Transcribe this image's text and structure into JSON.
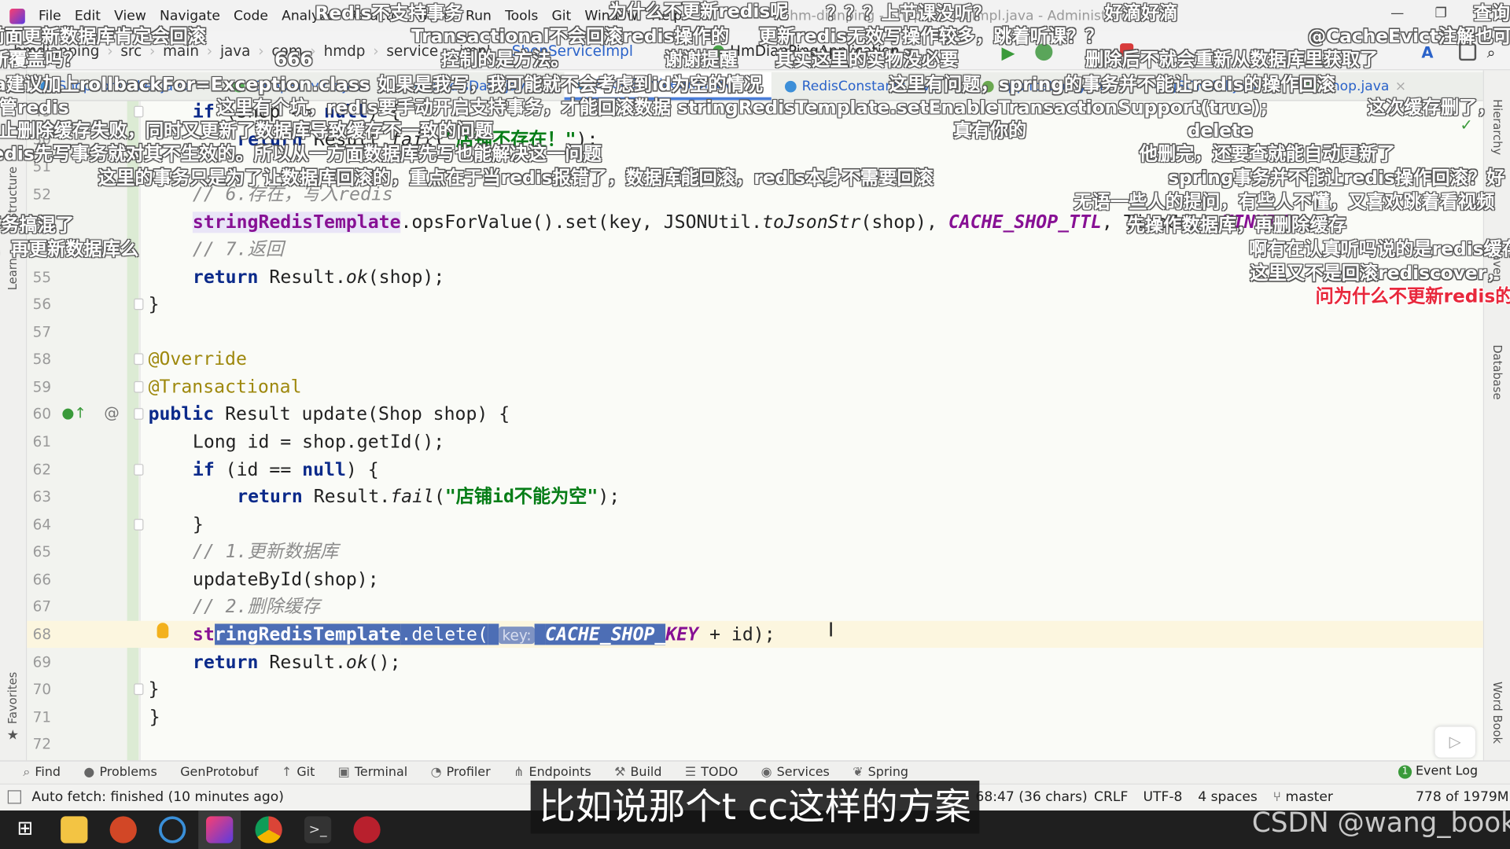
{
  "menu": [
    "File",
    "Edit",
    "View",
    "Navigate",
    "Code",
    "Analyze",
    "Refactor",
    "Build",
    "Run",
    "Tools",
    "Git",
    "Window",
    "Help"
  ],
  "window_title": "hm-dianping - ShopServiceImpl.java - Administrator",
  "breadcrumb": [
    "hmdianping",
    "src",
    "main",
    "java",
    "com",
    "hmdp",
    "service",
    "impl",
    "ShopServiceImpl"
  ],
  "run_config": "HmDianPingApplication",
  "tabs": [
    {
      "label": "ShopController.java",
      "color": "#3d8fd8",
      "active": false
    },
    {
      "label": "IShopService.java",
      "color": "#5cb85c",
      "active": false
    },
    {
      "label": "RedisData.java",
      "color": "#3d8fd8",
      "active": false
    },
    {
      "label": "ShopServiceImpl.java",
      "color": "#3d8fd8",
      "active": true
    },
    {
      "label": "RedisConstants.java",
      "color": "#3d8fd8",
      "active": false
    },
    {
      "label": "application.yaml",
      "color": "#6aa84f",
      "active": false
    },
    {
      "label": "JSONUtil.java",
      "color": "#3d8fd8",
      "active": false
    },
    {
      "label": "Shop.java",
      "color": "#5cb85c",
      "active": false
    }
  ],
  "left_tools": [
    "Structure",
    "Learn",
    "Favorites"
  ],
  "right_tools": [
    "Hierarchy",
    "Maven",
    "Database",
    "Word Book"
  ],
  "code": {
    "current_line": 68,
    "lines": [
      {
        "num": 49,
        "indent": 2,
        "tokens": [
          [
            "if",
            "kw"
          ],
          [
            " (shop == ",
            ""
          ],
          [
            "null",
            "kw"
          ],
          [
            ") {",
            ""
          ]
        ]
      },
      {
        "num": 50,
        "indent": 3,
        "tokens": [
          [
            "return",
            "kw"
          ],
          [
            " Result.",
            ""
          ],
          [
            "fail",
            "itl"
          ],
          [
            "(",
            ""
          ],
          [
            "\"店铺不存在！\"",
            "str"
          ],
          [
            ");",
            ""
          ]
        ]
      },
      {
        "num": 51,
        "indent": 0,
        "tokens": []
      },
      {
        "num": 52,
        "indent": 2,
        "tokens": [
          [
            "// 6.存在，写入redis",
            "cmt"
          ]
        ]
      },
      {
        "num": 53,
        "indent": 2,
        "tokens": [
          [
            "stringRedisTemplate",
            "fld hl"
          ],
          [
            ".opsForValue().set(key, JSONUtil.",
            ""
          ],
          [
            "toJsonStr",
            "itl"
          ],
          [
            "(shop), ",
            ""
          ],
          [
            "CACHE_SHOP_TTL",
            "cst"
          ],
          [
            ", TimeUnit.",
            ""
          ],
          [
            "MINUTES",
            "cst"
          ],
          [
            ");",
            ""
          ]
        ]
      },
      {
        "num": 54,
        "indent": 2,
        "tokens": [
          [
            "// 7.返回",
            "cmt"
          ]
        ]
      },
      {
        "num": 55,
        "indent": 2,
        "tokens": [
          [
            "return",
            "kw"
          ],
          [
            " Result.",
            ""
          ],
          [
            "ok",
            "itl"
          ],
          [
            "(shop);",
            ""
          ]
        ]
      },
      {
        "num": 56,
        "indent": 1,
        "tokens": [
          [
            "}",
            ""
          ]
        ]
      },
      {
        "num": 57,
        "indent": 0,
        "tokens": []
      },
      {
        "num": 58,
        "indent": 1,
        "tokens": [
          [
            "@Override",
            "ann"
          ]
        ]
      },
      {
        "num": 59,
        "indent": 1,
        "tokens": [
          [
            "@Transactional",
            "ann"
          ]
        ]
      },
      {
        "num": 60,
        "indent": 1,
        "tokens": [
          [
            "public",
            "kw"
          ],
          [
            " Result update(Shop shop) {",
            ""
          ]
        ]
      },
      {
        "num": 61,
        "indent": 2,
        "tokens": [
          [
            "Long id = shop.getId();",
            ""
          ]
        ]
      },
      {
        "num": 62,
        "indent": 2,
        "tokens": [
          [
            "if",
            "kw"
          ],
          [
            " (id == ",
            ""
          ],
          [
            "null",
            "kw"
          ],
          [
            ") {",
            ""
          ]
        ]
      },
      {
        "num": 63,
        "indent": 3,
        "tokens": [
          [
            "return",
            "kw"
          ],
          [
            " Result.",
            ""
          ],
          [
            "fail",
            "itl"
          ],
          [
            "(",
            ""
          ],
          [
            "\"店铺id不能为空\"",
            "str"
          ],
          [
            ");",
            ""
          ]
        ]
      },
      {
        "num": 64,
        "indent": 2,
        "tokens": [
          [
            "}",
            ""
          ]
        ]
      },
      {
        "num": 65,
        "indent": 2,
        "tokens": [
          [
            "// 1.更新数据库",
            "cmt"
          ]
        ]
      },
      {
        "num": 66,
        "indent": 2,
        "tokens": [
          [
            "updateById(shop);",
            ""
          ]
        ]
      },
      {
        "num": 67,
        "indent": 2,
        "tokens": [
          [
            "// 2.删除缓存",
            "cmt"
          ]
        ]
      },
      {
        "num": 68,
        "indent": 2,
        "tokens": [
          [
            "st",
            "fld"
          ],
          [
            "ringRedisTemplate",
            "fld sel"
          ],
          [
            ".delete(",
            "sel"
          ],
          [
            " ",
            "sel"
          ],
          [
            "key:",
            "hint sel"
          ],
          [
            " ",
            "sel"
          ],
          [
            "CACHE_SHOP_",
            "cst sel"
          ],
          [
            "KEY",
            "cst"
          ],
          [
            " + id);",
            ""
          ]
        ]
      },
      {
        "num": 69,
        "indent": 2,
        "tokens": [
          [
            "return",
            "kw"
          ],
          [
            " Result.",
            ""
          ],
          [
            "ok",
            "itl"
          ],
          [
            "();",
            ""
          ]
        ]
      },
      {
        "num": 70,
        "indent": 1,
        "tokens": [
          [
            "}",
            ""
          ]
        ]
      },
      {
        "num": 71,
        "indent": 0,
        "tokens": [
          [
            "}",
            ""
          ]
        ]
      },
      {
        "num": 72,
        "indent": 0,
        "tokens": []
      }
    ]
  },
  "tool_windows": [
    "Find",
    "Problems",
    "GenProtobuf",
    "Git",
    "Terminal",
    "Profiler",
    "Endpoints",
    "Build",
    "TODO",
    "Services",
    "Spring"
  ],
  "event_log": {
    "label": "Event Log",
    "count": "1"
  },
  "status": {
    "message": "Auto fetch: finished (10 minutes ago)",
    "position": "68:47 (36 chars)",
    "line_sep": "CRLF",
    "encoding": "UTF-8",
    "indent": "4 spaces",
    "branch": "master",
    "memory": "778 of 1979M"
  },
  "subtitle": "比如说那个t cc这样的方案",
  "watermark": "CSDN @wang_book",
  "danmaku": [
    {
      "text": "Redis不支持事务",
      "red": false
    },
    {
      "text": "为什么不更新redis呢",
      "red": false
    },
    {
      "text": "？？？上节课没听？",
      "red": false
    },
    {
      "text": "好滴好滴",
      "red": false
    },
    {
      "text": "查询",
      "red": false
    },
    {
      "text": "前面更新数据库肯定会回滚",
      "red": false
    },
    {
      "text": "Transactional不会回滚redis操作的",
      "red": false
    },
    {
      "text": "更新redis无效写操作较多，跳着听课？？",
      "red": false
    },
    {
      "text": "@CacheEvict注解也可以",
      "red": false
    },
    {
      "text": "新覆盖吗？",
      "red": false
    },
    {
      "text": "666",
      "red": false
    },
    {
      "text": "控制的是方法。",
      "red": false
    },
    {
      "text": "谢谢提醒",
      "red": false
    },
    {
      "text": "其实这里的实物没必要",
      "red": false
    },
    {
      "text": "删除后不就会重新从数据库里获取了",
      "red": false
    },
    {
      "text": "na建议加上rollbackFor=Exception.class",
      "red": false
    },
    {
      "text": "如果是我写，我可能就不会考虑到id为空的情况",
      "red": false
    },
    {
      "text": "这里有问题，spring的事务并不能让redis的操作回滚",
      "red": false
    },
    {
      "text": "说管redis",
      "red": false
    },
    {
      "text": "这里有个坑，redis要手动开启支持事务，才能回滚数据 stringRedisTemplate.setEnableTransactionSupport(true);",
      "red": false
    },
    {
      "text": "这次缓存删了，",
      "red": false
    },
    {
      "text": "防止删除缓存失败，同时又更新了数据库导致缓存不一致的问题",
      "red": false
    },
    {
      "text": "真有你的",
      "red": false
    },
    {
      "text": "delete",
      "red": false
    },
    {
      "text": "redis先写事务就对其不生效的。所以从一方面数据库先写也能解决这一问题",
      "red": false
    },
    {
      "text": "他删完，还要查就能自动更新了",
      "red": false
    },
    {
      "text": "这里的事务只是为了让数据库回滚的，重点在于当redis报错了，数据库能回滚，redis本身不需要回滚",
      "red": false
    },
    {
      "text": "spring事务并不能让redis操作回滚？好",
      "red": false
    },
    {
      "text": "无语一些人的提问，有些人不懂，又喜欢跳着看视频",
      "red": false
    },
    {
      "text": "事务搞混了",
      "red": false
    },
    {
      "text": "先操作数据库，再删除缓存",
      "red": false
    },
    {
      "text": "，再更新数据库么",
      "red": false
    },
    {
      "text": "啊有在认真听吗说的是redis缓存",
      "red": false
    },
    {
      "text": "这里又不是回滚rediscover，",
      "red": false
    },
    {
      "text": "问为什么不更新redis的",
      "red": true
    }
  ]
}
